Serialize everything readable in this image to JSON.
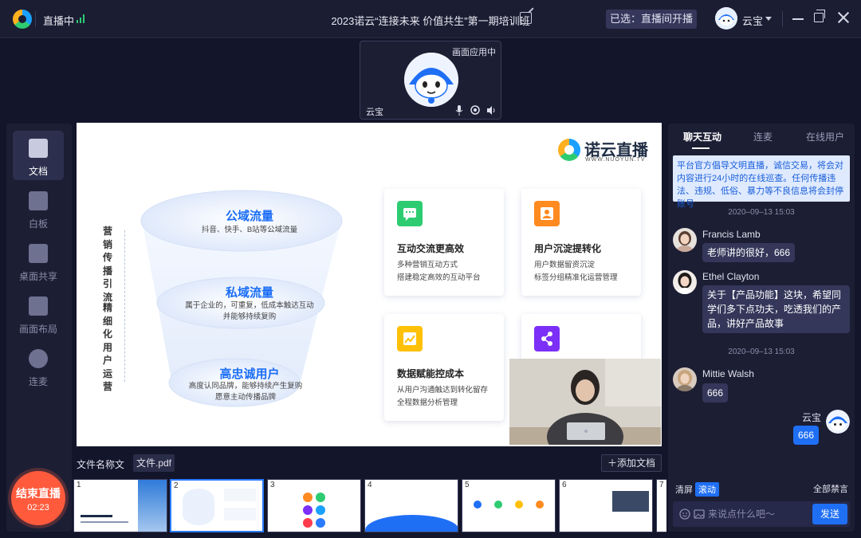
{
  "titlebar": {
    "live_status": "直播中",
    "title": "2023诺云“连接未来 价值共生”第一期培训班",
    "selected_label": "已选：直播间开播",
    "user_name": "云宝"
  },
  "camera": {
    "status": "画面应用中",
    "name": "云宝"
  },
  "left_toolbar": {
    "items": [
      {
        "label": "文档",
        "icon": "document-icon",
        "active": true
      },
      {
        "label": "白板",
        "icon": "whiteboard-icon",
        "active": false
      },
      {
        "label": "桌面共享",
        "icon": "screen-share-icon",
        "active": false
      },
      {
        "label": "画面布局",
        "icon": "layout-grid-icon",
        "active": false
      },
      {
        "label": "连麦",
        "icon": "mic-link-icon",
        "active": false
      }
    ],
    "end_label": "结束直播",
    "end_time": "02:23"
  },
  "slide": {
    "brand_name": "诺云直播",
    "brand_sub": "WWW.NUOYUN.TV",
    "vertical_1": "营销传播引流",
    "vertical_2": "精细化用户运营",
    "tiers": [
      {
        "title": "公域流量",
        "desc": "抖音、快手、B站等公域流量"
      },
      {
        "title": "私域流量",
        "desc": "属于企业的，可重复，低成本触达互动\n并能够持续复购"
      },
      {
        "title": "高忠诚用户",
        "desc": "高度认同品牌，能够持续产生复购\n愿意主动传播品牌"
      }
    ],
    "cards": [
      {
        "title": "互动交流更高效",
        "desc": "多种营销互动方式\n搭建稳定高效的互动平台",
        "icon": "chat-icon",
        "color": "#2ecc71"
      },
      {
        "title": "用户沉淀提转化",
        "desc": "用户数据留资沉淀\n标签分组精准化运营管理",
        "icon": "user-icon",
        "color": "#ff8a1f"
      },
      {
        "title": "数据赋能控成本",
        "desc": "从用户沟通触达到转化留存\n全程数据分析管理",
        "icon": "chart-icon",
        "color": "#ffc107"
      },
      {
        "title": "",
        "desc": "",
        "icon": "share-icon",
        "color": "#7b2ff7"
      }
    ]
  },
  "files": {
    "label": "文件名称文",
    "name": "文件.pdf",
    "add_label": "添加文档",
    "thumbs": [
      "1",
      "2",
      "3",
      "4",
      "5",
      "6",
      "7"
    ]
  },
  "chat": {
    "tabs": [
      "聊天互动",
      "连麦",
      "在线用户"
    ],
    "notice": "平台官方倡导文明直播，诚信交易，将会对内容进行24小时的在线巡查。任何传播违法、违规、低俗、暴力等不良信息将会封停账号",
    "timestamps": [
      "2020–09–13  15:03",
      "2020–09–13  15:03"
    ],
    "messages": [
      {
        "name": "Francis Lamb",
        "text": "老师讲的很好，666"
      },
      {
        "name": "Ethel Clayton",
        "text": "关于【产品功能】这块，希望同学们多下点功夫，吃透我们的产品，讲好产品故事"
      },
      {
        "name": "Mittie Walsh",
        "text": "666"
      },
      {
        "name": "云宝",
        "text": "666"
      }
    ],
    "btn_clear": "清屏",
    "btn_scroll": "滚动",
    "btn_mute": "全部禁言",
    "input_placeholder": "来说点什么吧～",
    "send_label": "发送"
  }
}
